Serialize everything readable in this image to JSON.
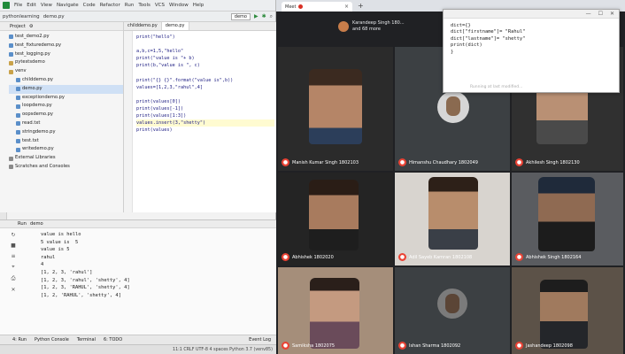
{
  "ide": {
    "menu": [
      "File",
      "Edit",
      "View",
      "Navigate",
      "Code",
      "Refactor",
      "Run",
      "Tools",
      "VCS",
      "Window",
      "Help"
    ],
    "breadcrumb": "pythonlearning",
    "breadcrumb_file": "demo.py",
    "run_config": "demo",
    "project_panel_title": "Project",
    "project_tree": [
      {
        "label": "test_demo2.py",
        "kind": "py"
      },
      {
        "label": "test_fixturedemo.py",
        "kind": "py"
      },
      {
        "label": "test_logging.py",
        "kind": "py"
      },
      {
        "label": "pytestsdemo",
        "kind": "folder"
      },
      {
        "label": "venv",
        "kind": "folder"
      },
      {
        "label": "childdemo.py",
        "kind": "py"
      },
      {
        "label": "demo.py",
        "kind": "py",
        "selected": true
      },
      {
        "label": "exceptiondemo.py",
        "kind": "py"
      },
      {
        "label": "loopdemo.py",
        "kind": "py"
      },
      {
        "label": "oopsdemo.py",
        "kind": "py"
      },
      {
        "label": "read.txt",
        "kind": "py"
      },
      {
        "label": "stringdemo.py",
        "kind": "py"
      },
      {
        "label": "test.txt",
        "kind": "py"
      },
      {
        "label": "writedemo.py",
        "kind": "py"
      },
      {
        "label": "External Libraries",
        "kind": "lib"
      },
      {
        "label": "Scratches and Consoles",
        "kind": "lib"
      }
    ],
    "editor_tabs": [
      "childdemo.py",
      "demo.py"
    ],
    "code": [
      "print(\"hello\")",
      "",
      "a,b,c=1,5,\"hello\"",
      "print(\"value is \"+ b)",
      "print(b,\"value is \", c)",
      "",
      "print(\"{} {}\".format(\"value is\",b))",
      "values=[1,2,3,\"rahul\",4]",
      "",
      "print(values[0])",
      "print(values[-1])",
      "print(values[1:3])",
      "values.insert(3,\"shetty\")",
      "print(values)"
    ],
    "run_panel_title": "Run",
    "run_config_tab": "demo",
    "console_output": [
      "value is hello",
      "5 value is  5",
      "value is 5",
      "rahul",
      "4",
      "[1, 2, 3, 'rahul']",
      "[1, 2, 3, 'rahul', 'shetty', 4]",
      "[1, 2, 3, 'RAHUL', 'shetty', 4]",
      "[1, 2, 'RAHUL', 'shetty', 4]"
    ],
    "bottom_tabs": [
      "4: Run",
      "Python Console",
      "Terminal",
      "6: TODO",
      "Event Log"
    ],
    "status": "11:1  CRLF  UTF-8  4 spaces  Python 3.7 (venv85)"
  },
  "browser": {
    "tab_title": "Meet",
    "participants": [
      {
        "name": "Manish Kumar Singh 1802103",
        "kind": "video"
      },
      {
        "name": "Himanshu Chaudhary 1802049",
        "kind": "avatar"
      },
      {
        "name": "Akhilesh Singh 1802130",
        "kind": "video"
      },
      {
        "name": "Abhishek 1802020",
        "kind": "video"
      },
      {
        "name": "Adil Sayeb Kamran 1802108",
        "kind": "video"
      },
      {
        "name": "Abhishek Singh 1802164",
        "kind": "video"
      },
      {
        "name": "Samiksha 1802075",
        "kind": "video"
      },
      {
        "name": "Ishan Sharma 1802092",
        "kind": "avatar"
      },
      {
        "name": "Jashandeep 1802098",
        "kind": "video"
      }
    ],
    "top_chip": {
      "line1": "Karandeep Singh 180...",
      "line2": "and 68 more"
    }
  },
  "notepad": {
    "lines": [
      "dict={}",
      "dict[\"firstname\"]= \"Rahul\"",
      "dict[\"lastname\"]= \"shetty\"",
      "print(dict)",
      "}"
    ],
    "hint": "Running at last modified..."
  }
}
